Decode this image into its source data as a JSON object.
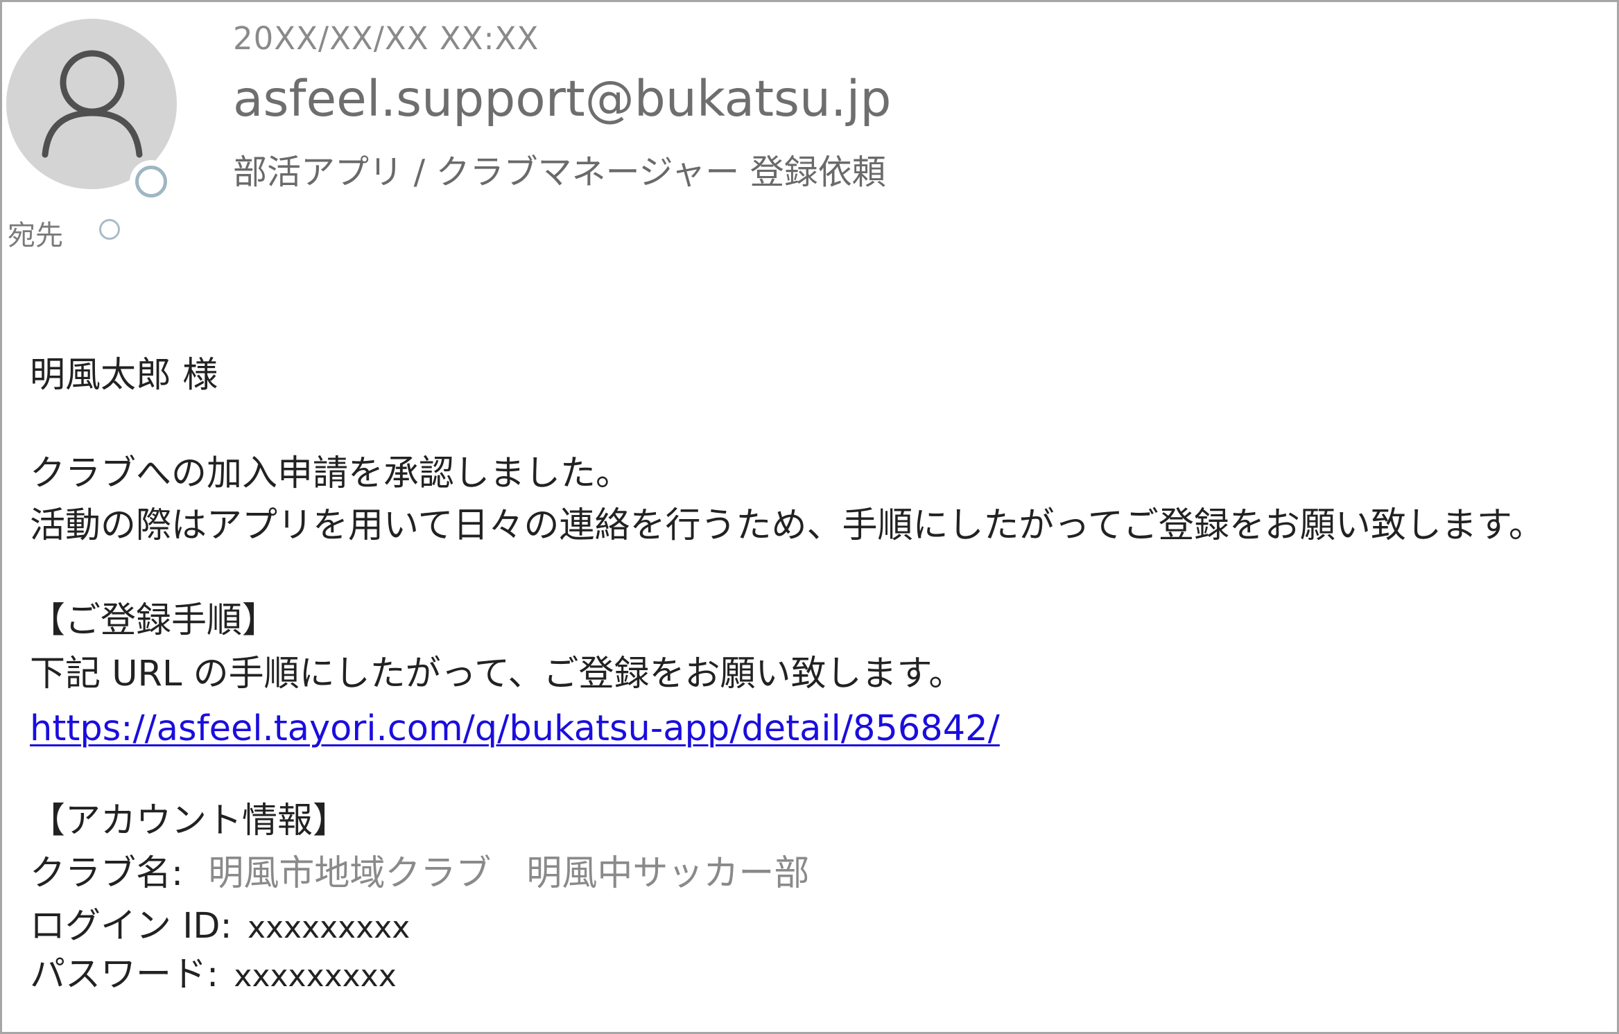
{
  "email": {
    "datetime": "20XX/XX/XX XX:XX",
    "sender": "asfeel.support@bukatsu.jp",
    "subject": "部活アプリ / クラブマネージャー 登録依頼",
    "to_label": "宛先"
  },
  "body": {
    "greeting": "明風太郎 様",
    "para1_line1": "クラブへの加入申請を承認しました。",
    "para1_line2": "活動の際はアプリを用いて日々の連絡を行うため、手順にしたがってご登録をお願い致します。",
    "registration_heading": "【ご登録手順】",
    "registration_text": "下記 URL の手順にしたがって、ご登録をお願い致します。",
    "registration_link": "https://asfeel.tayori.com/q/bukatsu-app/detail/856842/",
    "account_heading": "【アカウント情報】",
    "club_label": "クラブ名:",
    "club_value": "明風市地域クラブ　明風中サッカー部",
    "login_label": "ログイン ID:",
    "login_value": "xxxxxxxxx",
    "password_label": "パスワード:",
    "password_value": "xxxxxxxxx"
  },
  "icons": {
    "avatar": "user-avatar-icon",
    "presence": "presence-status-icon",
    "recipient_status": "recipient-status-icon"
  },
  "colors": {
    "link": "#1a0dde",
    "avatar_bg": "#d4d4d4",
    "border": "#a6a6a6"
  }
}
